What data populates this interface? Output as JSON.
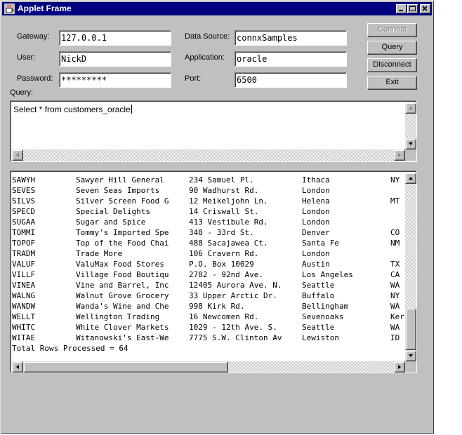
{
  "window": {
    "title": "Applet Frame"
  },
  "form": {
    "gateway": {
      "label": "Gateway:",
      "value": "127.0.0.1"
    },
    "user": {
      "label": "User:",
      "value": "NickD"
    },
    "password": {
      "label": "Password:",
      "value": "*********"
    },
    "data_source": {
      "label": "Data Source:",
      "value": "connxSamples"
    },
    "application": {
      "label": "Application:",
      "value": "oracle"
    },
    "port": {
      "label": "Port:",
      "value": "6500"
    }
  },
  "buttons": {
    "connect": "Connect",
    "query": "Query",
    "disconnect": "Disconnect",
    "exit": "Exit"
  },
  "query": {
    "label": "Query:",
    "text": "Select * from customers_oracle"
  },
  "results": {
    "rows": [
      [
        "SAWYH",
        "Sawyer Hill General",
        "234 Samuel Pl.",
        "Ithaca",
        "NY"
      ],
      [
        "SEVES",
        "Seven Seas Imports",
        "90 Wadhurst Rd.",
        "London",
        ""
      ],
      [
        "SILVS",
        "Silver Screen Food G",
        "12 Meikeljohn Ln.",
        "Helena",
        "MT"
      ],
      [
        "SPECD",
        "Special Delights",
        "14 Criswall St.",
        "London",
        ""
      ],
      [
        "SUGAA",
        "Sugar and Spice",
        "413 Vestibule Rd.",
        "London",
        ""
      ],
      [
        "TOMMI",
        "Tommy's Imported Spe",
        "348 - 33rd St.",
        "Denver",
        "CO"
      ],
      [
        "TOPOF",
        "Top of the Food Chai",
        "488 Sacajawea Ct.",
        "Santa Fe",
        "NM"
      ],
      [
        "TRADM",
        "Trade More",
        "106 Cravern Rd.",
        "London",
        ""
      ],
      [
        "VALUF",
        "ValuMax Food Stores",
        "P.O. Box 10029",
        "Austin",
        "TX"
      ],
      [
        "VILLF",
        "Village Food Boutiqu",
        "2782 - 92nd Ave.",
        "Los Angeles",
        "CA"
      ],
      [
        "VINEA",
        "Vine and Barrel, Inc",
        "12405 Aurora Ave. N.",
        "Seattle",
        "WA"
      ],
      [
        "WALNG",
        "Walnut Grove Grocery",
        "33 Upper Arctic Dr.",
        "Buffalo",
        "NY"
      ],
      [
        "WANDW",
        "Wanda's Wine and Che",
        "998 Kirk Rd.",
        "Bellingham",
        "WA"
      ],
      [
        "WELLT",
        "Wellington Trading",
        "16 Newcomen Rd.",
        "Sevenoaks",
        "Ker"
      ],
      [
        "WHITC",
        "White Clover Markets",
        "1029 - 12th Ave. S.",
        "Seattle",
        "WA"
      ],
      [
        "WITAE",
        "Witanowski's East-We",
        "7775 S.W. Clinton Av",
        "Lewiston",
        "ID"
      ]
    ],
    "total": "Total Rows Processed = 64"
  }
}
